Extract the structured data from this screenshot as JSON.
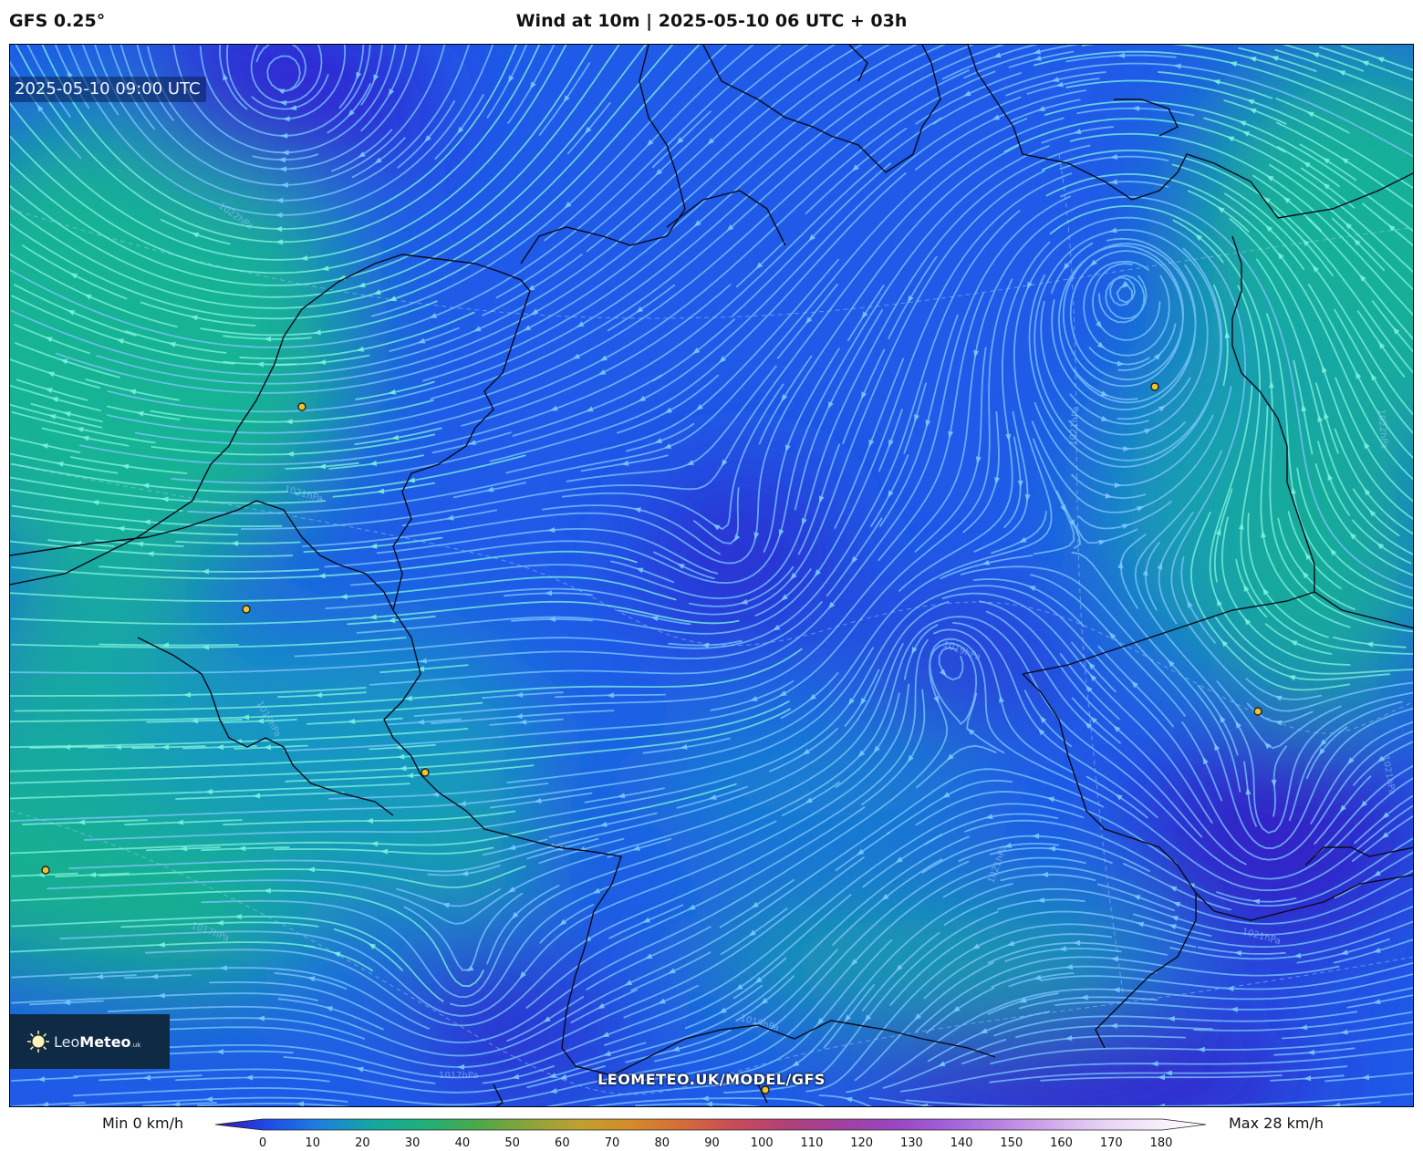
{
  "header": {
    "model": "GFS 0.25°",
    "title": "Wind at 10m | 2025-05-10 06 UTC + 03h"
  },
  "map": {
    "timestamp": "2025-05-10 09:00 UTC",
    "watermark": "LEOMETEO.UK/MODEL/GFS",
    "isobar_labels": [
      "1022hPa",
      "1021hPa",
      "1021hPa",
      "1022hPa",
      "1019hPa",
      "1017hPa",
      "1019hPa",
      "1021hPa",
      "1021hPa",
      "1017hPa",
      "1019hPa",
      "1021hPa"
    ],
    "city_markers": 8
  },
  "logo": {
    "name_light": "Leo",
    "name_bold": "Meteo",
    "suffix": ".uk"
  },
  "legend": {
    "min_label": "Min 0 km/h",
    "max_label": "Max 28 km/h",
    "ticks": [
      "0",
      "10",
      "20",
      "30",
      "40",
      "50",
      "60",
      "70",
      "80",
      "90",
      "100",
      "110",
      "120",
      "130",
      "140",
      "150",
      "160",
      "170",
      "180"
    ],
    "colors": [
      "#3a10c0",
      "#1f4ae6",
      "#1e7fe0",
      "#13a7a0",
      "#1fb07a",
      "#4aa84a",
      "#8aa43a",
      "#c0a030",
      "#d48a2a",
      "#d46a3a",
      "#c84a5a",
      "#b0407a",
      "#a040a0",
      "#9a44c0",
      "#a060d8",
      "#b880e0",
      "#d0a8ec",
      "#e6d2f4",
      "#f6ecfa",
      "#ffffff"
    ]
  }
}
